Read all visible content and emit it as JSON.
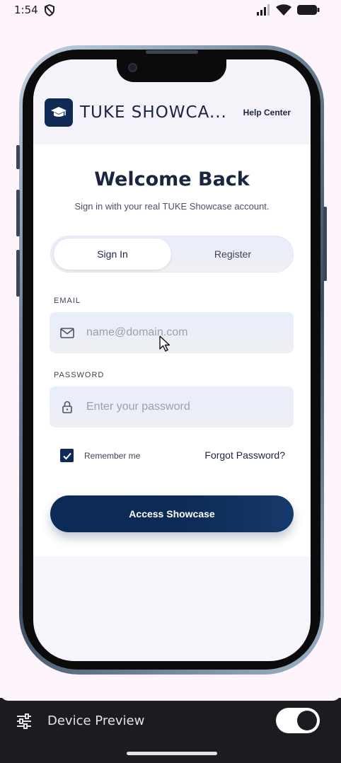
{
  "status_bar": {
    "time": "1:54"
  },
  "app": {
    "title": "TUKE SHOWCA...",
    "help_center": "Help Center",
    "logo_icon": "graduation-cap-icon"
  },
  "login": {
    "heading": "Welcome Back",
    "subheading": "Sign in with your real TUKE Showcase account.",
    "tabs": [
      {
        "label": "Sign In",
        "active": true
      },
      {
        "label": "Register",
        "active": false
      }
    ],
    "email": {
      "label": "EMAIL",
      "placeholder": "name@domain.com",
      "value": ""
    },
    "password": {
      "label": "PASSWORD",
      "placeholder": "Enter your password",
      "value": ""
    },
    "remember_me": {
      "label": "Remember me",
      "checked": true
    },
    "forgot_password": "Forgot Password?",
    "submit": "Access Showcase"
  },
  "host": {
    "device_preview_label": "Device Preview",
    "device_preview_enabled": true
  },
  "colors": {
    "primary": "#0e2a55",
    "background": "#fdf5fb",
    "host_bar": "#1c1b1f"
  }
}
